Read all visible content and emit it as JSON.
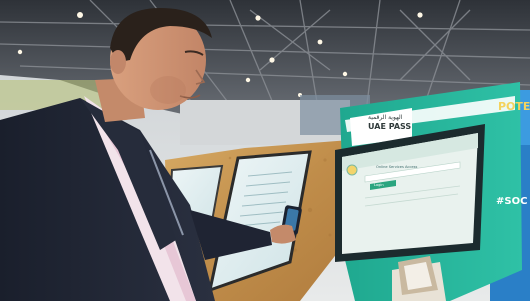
{
  "photo": {
    "subject": "UAE PASS kiosk",
    "kiosk": {
      "brand_arabic": "الهوية الرقمية",
      "brand_latin": "UAE PASS",
      "screen_heading": "Online Services Access",
      "button_label": "Login"
    },
    "side_banner": {
      "hashtag": "#SOC",
      "word": "POTE"
    },
    "colors": {
      "kiosk_green": "#25b49a",
      "osb_wood": "#c89a55",
      "suit": "#1c2130",
      "ceiling": "#3b3f46"
    }
  }
}
